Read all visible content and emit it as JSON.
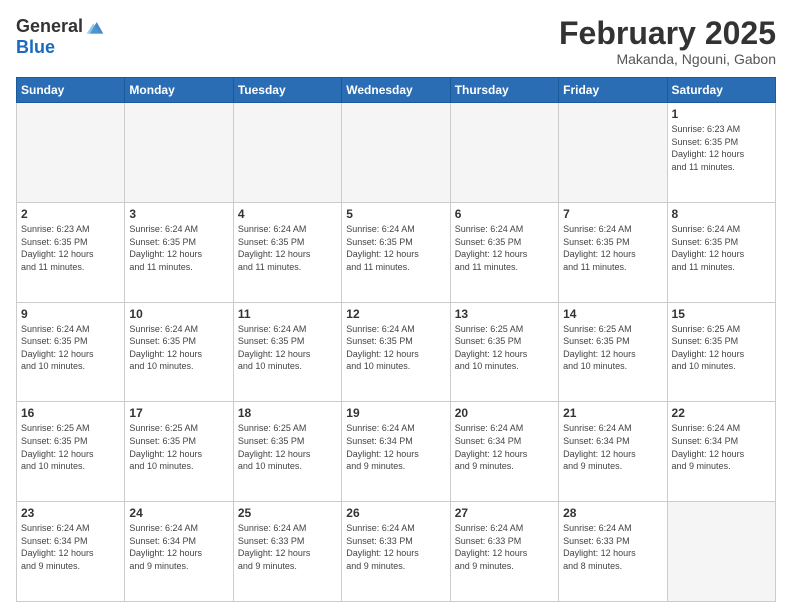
{
  "header": {
    "logo_general": "General",
    "logo_blue": "Blue",
    "month_title": "February 2025",
    "location": "Makanda, Ngouni, Gabon"
  },
  "weekdays": [
    "Sunday",
    "Monday",
    "Tuesday",
    "Wednesday",
    "Thursday",
    "Friday",
    "Saturday"
  ],
  "days": [
    {
      "date": "",
      "info": ""
    },
    {
      "date": "",
      "info": ""
    },
    {
      "date": "",
      "info": ""
    },
    {
      "date": "",
      "info": ""
    },
    {
      "date": "",
      "info": ""
    },
    {
      "date": "",
      "info": ""
    },
    {
      "date": "1",
      "info": "Sunrise: 6:23 AM\nSunset: 6:35 PM\nDaylight: 12 hours\nand 11 minutes."
    },
    {
      "date": "2",
      "info": "Sunrise: 6:23 AM\nSunset: 6:35 PM\nDaylight: 12 hours\nand 11 minutes."
    },
    {
      "date": "3",
      "info": "Sunrise: 6:24 AM\nSunset: 6:35 PM\nDaylight: 12 hours\nand 11 minutes."
    },
    {
      "date": "4",
      "info": "Sunrise: 6:24 AM\nSunset: 6:35 PM\nDaylight: 12 hours\nand 11 minutes."
    },
    {
      "date": "5",
      "info": "Sunrise: 6:24 AM\nSunset: 6:35 PM\nDaylight: 12 hours\nand 11 minutes."
    },
    {
      "date": "6",
      "info": "Sunrise: 6:24 AM\nSunset: 6:35 PM\nDaylight: 12 hours\nand 11 minutes."
    },
    {
      "date": "7",
      "info": "Sunrise: 6:24 AM\nSunset: 6:35 PM\nDaylight: 12 hours\nand 11 minutes."
    },
    {
      "date": "8",
      "info": "Sunrise: 6:24 AM\nSunset: 6:35 PM\nDaylight: 12 hours\nand 11 minutes."
    },
    {
      "date": "9",
      "info": "Sunrise: 6:24 AM\nSunset: 6:35 PM\nDaylight: 12 hours\nand 10 minutes."
    },
    {
      "date": "10",
      "info": "Sunrise: 6:24 AM\nSunset: 6:35 PM\nDaylight: 12 hours\nand 10 minutes."
    },
    {
      "date": "11",
      "info": "Sunrise: 6:24 AM\nSunset: 6:35 PM\nDaylight: 12 hours\nand 10 minutes."
    },
    {
      "date": "12",
      "info": "Sunrise: 6:24 AM\nSunset: 6:35 PM\nDaylight: 12 hours\nand 10 minutes."
    },
    {
      "date": "13",
      "info": "Sunrise: 6:25 AM\nSunset: 6:35 PM\nDaylight: 12 hours\nand 10 minutes."
    },
    {
      "date": "14",
      "info": "Sunrise: 6:25 AM\nSunset: 6:35 PM\nDaylight: 12 hours\nand 10 minutes."
    },
    {
      "date": "15",
      "info": "Sunrise: 6:25 AM\nSunset: 6:35 PM\nDaylight: 12 hours\nand 10 minutes."
    },
    {
      "date": "16",
      "info": "Sunrise: 6:25 AM\nSunset: 6:35 PM\nDaylight: 12 hours\nand 10 minutes."
    },
    {
      "date": "17",
      "info": "Sunrise: 6:25 AM\nSunset: 6:35 PM\nDaylight: 12 hours\nand 10 minutes."
    },
    {
      "date": "18",
      "info": "Sunrise: 6:25 AM\nSunset: 6:35 PM\nDaylight: 12 hours\nand 10 minutes."
    },
    {
      "date": "19",
      "info": "Sunrise: 6:24 AM\nSunset: 6:34 PM\nDaylight: 12 hours\nand 9 minutes."
    },
    {
      "date": "20",
      "info": "Sunrise: 6:24 AM\nSunset: 6:34 PM\nDaylight: 12 hours\nand 9 minutes."
    },
    {
      "date": "21",
      "info": "Sunrise: 6:24 AM\nSunset: 6:34 PM\nDaylight: 12 hours\nand 9 minutes."
    },
    {
      "date": "22",
      "info": "Sunrise: 6:24 AM\nSunset: 6:34 PM\nDaylight: 12 hours\nand 9 minutes."
    },
    {
      "date": "23",
      "info": "Sunrise: 6:24 AM\nSunset: 6:34 PM\nDaylight: 12 hours\nand 9 minutes."
    },
    {
      "date": "24",
      "info": "Sunrise: 6:24 AM\nSunset: 6:34 PM\nDaylight: 12 hours\nand 9 minutes."
    },
    {
      "date": "25",
      "info": "Sunrise: 6:24 AM\nSunset: 6:33 PM\nDaylight: 12 hours\nand 9 minutes."
    },
    {
      "date": "26",
      "info": "Sunrise: 6:24 AM\nSunset: 6:33 PM\nDaylight: 12 hours\nand 9 minutes."
    },
    {
      "date": "27",
      "info": "Sunrise: 6:24 AM\nSunset: 6:33 PM\nDaylight: 12 hours\nand 9 minutes."
    },
    {
      "date": "28",
      "info": "Sunrise: 6:24 AM\nSunset: 6:33 PM\nDaylight: 12 hours\nand 8 minutes."
    },
    {
      "date": "",
      "info": ""
    },
    {
      "date": "",
      "info": ""
    }
  ]
}
